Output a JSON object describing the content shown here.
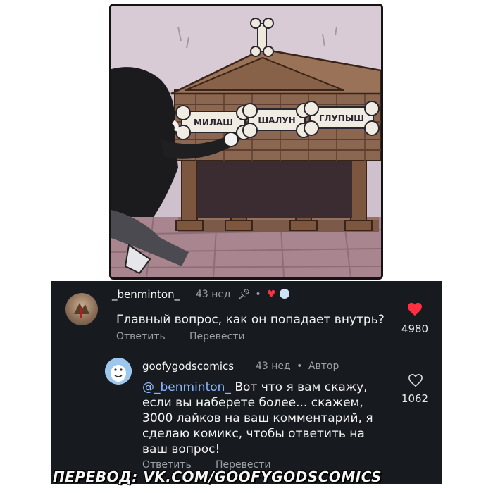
{
  "comic": {
    "bones": [
      "МИЛАШ",
      "ШАЛУН",
      "ГЛУПЫШ"
    ]
  },
  "comment": {
    "username": "_benminton_",
    "time": "43 нед",
    "text": "Главный вопрос, как он попадает внутрь?",
    "reply_label": "Ответить",
    "translate_label": "Перевести",
    "likes": "4980",
    "heart_color": "#ff3040"
  },
  "reply": {
    "username": "goofygodscomics",
    "time": "43 нед",
    "author_badge": "Автор",
    "mention": "@_benminton_",
    "text": " Вот что я вам скажу, если вы наберете более... скажем, 3000 лайков на ваш комментарий, я сделаю комикс, чтобы ответить на ваш вопрос!",
    "reply_label": "Ответить",
    "translate_label": "Перевести",
    "likes": "1062"
  },
  "watermark": "ПЕРЕВОД: VK.COM/GOOFYGODSCOMICS"
}
